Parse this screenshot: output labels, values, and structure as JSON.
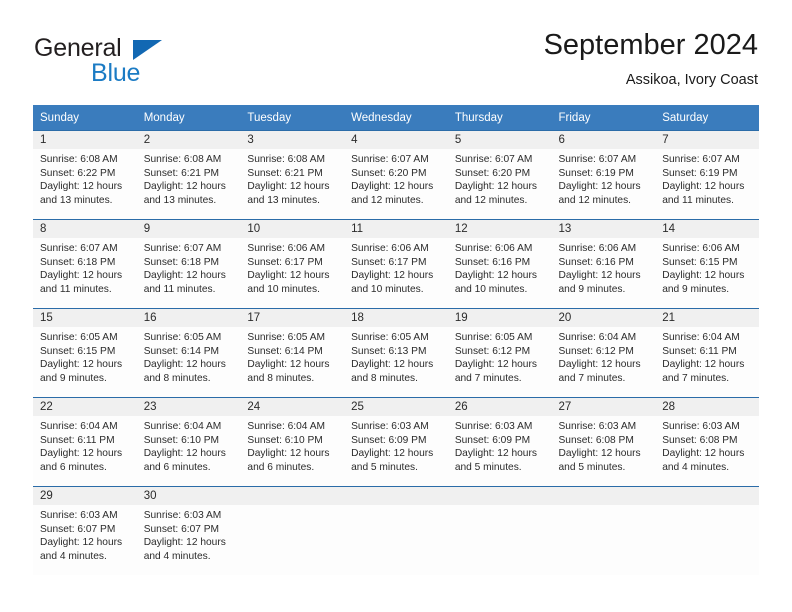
{
  "brand": {
    "name_part1": "General",
    "name_part2": "Blue",
    "triangle_color": "#1268b3",
    "blue_text_color": "#1b7bc4"
  },
  "header": {
    "title": "September 2024",
    "subtitle": "Assikoa, Ivory Coast"
  },
  "theme": {
    "header_bg": "#3a7cbd",
    "header_text": "#ffffff",
    "row_rule": "#2b6ca8",
    "daynum_band_bg": "#f0f0f0",
    "cell_bg": "#fdfdfd",
    "body_text": "#2b2b2b"
  },
  "calendar": {
    "weekday_headers": [
      "Sunday",
      "Monday",
      "Tuesday",
      "Wednesday",
      "Thursday",
      "Friday",
      "Saturday"
    ],
    "weeks": [
      [
        {
          "day": "1",
          "sunrise": "Sunrise: 6:08 AM",
          "sunset": "Sunset: 6:22 PM",
          "daylight_line1": "Daylight: 12 hours",
          "daylight_line2": "and 13 minutes."
        },
        {
          "day": "2",
          "sunrise": "Sunrise: 6:08 AM",
          "sunset": "Sunset: 6:21 PM",
          "daylight_line1": "Daylight: 12 hours",
          "daylight_line2": "and 13 minutes."
        },
        {
          "day": "3",
          "sunrise": "Sunrise: 6:08 AM",
          "sunset": "Sunset: 6:21 PM",
          "daylight_line1": "Daylight: 12 hours",
          "daylight_line2": "and 13 minutes."
        },
        {
          "day": "4",
          "sunrise": "Sunrise: 6:07 AM",
          "sunset": "Sunset: 6:20 PM",
          "daylight_line1": "Daylight: 12 hours",
          "daylight_line2": "and 12 minutes."
        },
        {
          "day": "5",
          "sunrise": "Sunrise: 6:07 AM",
          "sunset": "Sunset: 6:20 PM",
          "daylight_line1": "Daylight: 12 hours",
          "daylight_line2": "and 12 minutes."
        },
        {
          "day": "6",
          "sunrise": "Sunrise: 6:07 AM",
          "sunset": "Sunset: 6:19 PM",
          "daylight_line1": "Daylight: 12 hours",
          "daylight_line2": "and 12 minutes."
        },
        {
          "day": "7",
          "sunrise": "Sunrise: 6:07 AM",
          "sunset": "Sunset: 6:19 PM",
          "daylight_line1": "Daylight: 12 hours",
          "daylight_line2": "and 11 minutes."
        }
      ],
      [
        {
          "day": "8",
          "sunrise": "Sunrise: 6:07 AM",
          "sunset": "Sunset: 6:18 PM",
          "daylight_line1": "Daylight: 12 hours",
          "daylight_line2": "and 11 minutes."
        },
        {
          "day": "9",
          "sunrise": "Sunrise: 6:07 AM",
          "sunset": "Sunset: 6:18 PM",
          "daylight_line1": "Daylight: 12 hours",
          "daylight_line2": "and 11 minutes."
        },
        {
          "day": "10",
          "sunrise": "Sunrise: 6:06 AM",
          "sunset": "Sunset: 6:17 PM",
          "daylight_line1": "Daylight: 12 hours",
          "daylight_line2": "and 10 minutes."
        },
        {
          "day": "11",
          "sunrise": "Sunrise: 6:06 AM",
          "sunset": "Sunset: 6:17 PM",
          "daylight_line1": "Daylight: 12 hours",
          "daylight_line2": "and 10 minutes."
        },
        {
          "day": "12",
          "sunrise": "Sunrise: 6:06 AM",
          "sunset": "Sunset: 6:16 PM",
          "daylight_line1": "Daylight: 12 hours",
          "daylight_line2": "and 10 minutes."
        },
        {
          "day": "13",
          "sunrise": "Sunrise: 6:06 AM",
          "sunset": "Sunset: 6:16 PM",
          "daylight_line1": "Daylight: 12 hours",
          "daylight_line2": "and 9 minutes."
        },
        {
          "day": "14",
          "sunrise": "Sunrise: 6:06 AM",
          "sunset": "Sunset: 6:15 PM",
          "daylight_line1": "Daylight: 12 hours",
          "daylight_line2": "and 9 minutes."
        }
      ],
      [
        {
          "day": "15",
          "sunrise": "Sunrise: 6:05 AM",
          "sunset": "Sunset: 6:15 PM",
          "daylight_line1": "Daylight: 12 hours",
          "daylight_line2": "and 9 minutes."
        },
        {
          "day": "16",
          "sunrise": "Sunrise: 6:05 AM",
          "sunset": "Sunset: 6:14 PM",
          "daylight_line1": "Daylight: 12 hours",
          "daylight_line2": "and 8 minutes."
        },
        {
          "day": "17",
          "sunrise": "Sunrise: 6:05 AM",
          "sunset": "Sunset: 6:14 PM",
          "daylight_line1": "Daylight: 12 hours",
          "daylight_line2": "and 8 minutes."
        },
        {
          "day": "18",
          "sunrise": "Sunrise: 6:05 AM",
          "sunset": "Sunset: 6:13 PM",
          "daylight_line1": "Daylight: 12 hours",
          "daylight_line2": "and 8 minutes."
        },
        {
          "day": "19",
          "sunrise": "Sunrise: 6:05 AM",
          "sunset": "Sunset: 6:12 PM",
          "daylight_line1": "Daylight: 12 hours",
          "daylight_line2": "and 7 minutes."
        },
        {
          "day": "20",
          "sunrise": "Sunrise: 6:04 AM",
          "sunset": "Sunset: 6:12 PM",
          "daylight_line1": "Daylight: 12 hours",
          "daylight_line2": "and 7 minutes."
        },
        {
          "day": "21",
          "sunrise": "Sunrise: 6:04 AM",
          "sunset": "Sunset: 6:11 PM",
          "daylight_line1": "Daylight: 12 hours",
          "daylight_line2": "and 7 minutes."
        }
      ],
      [
        {
          "day": "22",
          "sunrise": "Sunrise: 6:04 AM",
          "sunset": "Sunset: 6:11 PM",
          "daylight_line1": "Daylight: 12 hours",
          "daylight_line2": "and 6 minutes."
        },
        {
          "day": "23",
          "sunrise": "Sunrise: 6:04 AM",
          "sunset": "Sunset: 6:10 PM",
          "daylight_line1": "Daylight: 12 hours",
          "daylight_line2": "and 6 minutes."
        },
        {
          "day": "24",
          "sunrise": "Sunrise: 6:04 AM",
          "sunset": "Sunset: 6:10 PM",
          "daylight_line1": "Daylight: 12 hours",
          "daylight_line2": "and 6 minutes."
        },
        {
          "day": "25",
          "sunrise": "Sunrise: 6:03 AM",
          "sunset": "Sunset: 6:09 PM",
          "daylight_line1": "Daylight: 12 hours",
          "daylight_line2": "and 5 minutes."
        },
        {
          "day": "26",
          "sunrise": "Sunrise: 6:03 AM",
          "sunset": "Sunset: 6:09 PM",
          "daylight_line1": "Daylight: 12 hours",
          "daylight_line2": "and 5 minutes."
        },
        {
          "day": "27",
          "sunrise": "Sunrise: 6:03 AM",
          "sunset": "Sunset: 6:08 PM",
          "daylight_line1": "Daylight: 12 hours",
          "daylight_line2": "and 5 minutes."
        },
        {
          "day": "28",
          "sunrise": "Sunrise: 6:03 AM",
          "sunset": "Sunset: 6:08 PM",
          "daylight_line1": "Daylight: 12 hours",
          "daylight_line2": "and 4 minutes."
        }
      ],
      [
        {
          "day": "29",
          "sunrise": "Sunrise: 6:03 AM",
          "sunset": "Sunset: 6:07 PM",
          "daylight_line1": "Daylight: 12 hours",
          "daylight_line2": "and 4 minutes."
        },
        {
          "day": "30",
          "sunrise": "Sunrise: 6:03 AM",
          "sunset": "Sunset: 6:07 PM",
          "daylight_line1": "Daylight: 12 hours",
          "daylight_line2": "and 4 minutes."
        },
        {
          "day": "",
          "sunrise": "",
          "sunset": "",
          "daylight_line1": "",
          "daylight_line2": ""
        },
        {
          "day": "",
          "sunrise": "",
          "sunset": "",
          "daylight_line1": "",
          "daylight_line2": ""
        },
        {
          "day": "",
          "sunrise": "",
          "sunset": "",
          "daylight_line1": "",
          "daylight_line2": ""
        },
        {
          "day": "",
          "sunrise": "",
          "sunset": "",
          "daylight_line1": "",
          "daylight_line2": ""
        },
        {
          "day": "",
          "sunrise": "",
          "sunset": "",
          "daylight_line1": "",
          "daylight_line2": ""
        }
      ]
    ]
  }
}
